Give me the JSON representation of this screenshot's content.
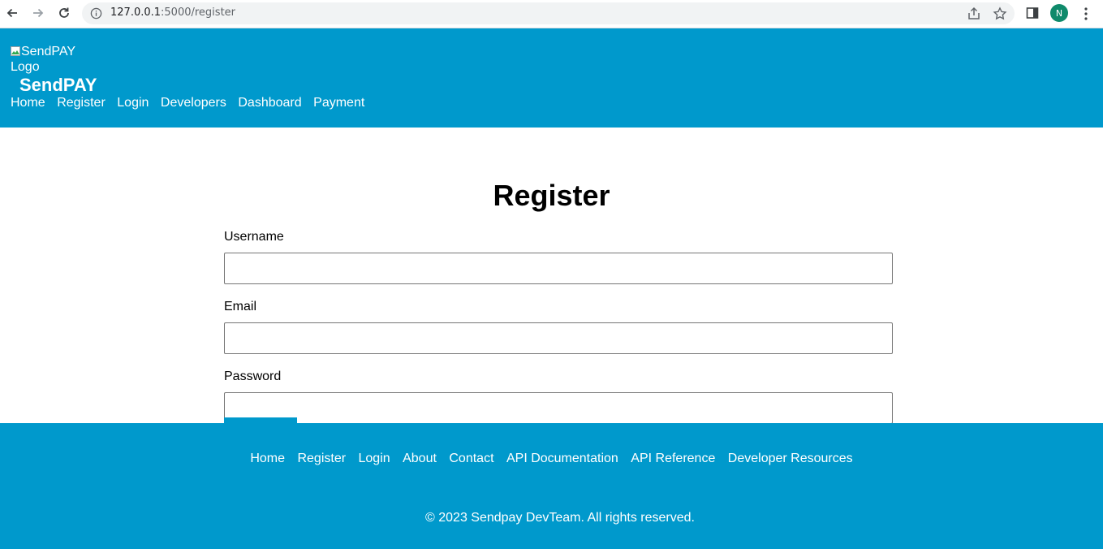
{
  "browser": {
    "url_host": "127.0.0.1",
    "url_path": ":5000/register",
    "profile_initial": "N",
    "profile_color": "#0f8a6b"
  },
  "header": {
    "logo_alt": "SendPAY Logo",
    "brand": "SendPAY",
    "nav": [
      "Home",
      "Register",
      "Login",
      "Developers",
      "Dashboard",
      "Payment"
    ],
    "background": "#0099cc"
  },
  "form": {
    "title": "Register",
    "fields": [
      {
        "label": "Username",
        "value": ""
      },
      {
        "label": "Email",
        "value": ""
      },
      {
        "label": "Password",
        "value": ""
      }
    ]
  },
  "footer": {
    "nav": [
      "Home",
      "Register",
      "Login",
      "About",
      "Contact",
      "API Documentation",
      "API Reference",
      "Developer Resources"
    ],
    "copyright": "© 2023 Sendpay DevTeam. All rights reserved."
  }
}
